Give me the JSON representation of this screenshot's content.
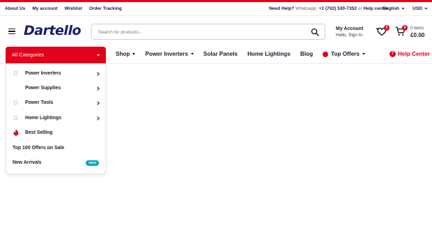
{
  "topbar": {
    "links": [
      "About Us",
      "My account",
      "Wishlist",
      "Order Tracking"
    ],
    "help_prefix": "Need Help?",
    "help_channel": "Whatsapp:",
    "help_phone": "+1 (702) 530-7352",
    "help_or": "or",
    "help_center": "Help center",
    "language": "English",
    "currency": "USD"
  },
  "header": {
    "logo": "Dartello",
    "search_placeholder": "Search for products...",
    "account_title": "My Account",
    "account_sub": "Hello, Sign In",
    "wishlist_count": "0",
    "cart_count": "0",
    "cart_items": "0 items",
    "cart_total": "£0.00"
  },
  "nav": {
    "all_categories": "All Categories",
    "items": [
      {
        "label": "Shop",
        "dropdown": true
      },
      {
        "label": "Power Inverters",
        "dropdown": true
      },
      {
        "label": "Solar Panels",
        "dropdown": false
      },
      {
        "label": "Home Lightings",
        "dropdown": false
      },
      {
        "label": "Blog",
        "dropdown": false
      },
      {
        "label": "Top Offers",
        "dropdown": true
      }
    ],
    "help_center": "Help Center"
  },
  "categories": [
    {
      "label": "Power Inverters",
      "icon": "box-icon",
      "submenu": true
    },
    {
      "label": "Power Supplies",
      "icon": "none",
      "submenu": true
    },
    {
      "label": "Power Tools",
      "icon": "box-icon",
      "submenu": true
    },
    {
      "label": "Home Lightings",
      "icon": "box-icon",
      "submenu": true
    },
    {
      "label": "Best Selling",
      "icon": "flame-icon",
      "submenu": false
    },
    {
      "label": "Top 100 Offers on Sale",
      "icon": "none",
      "submenu": false
    },
    {
      "label": "New Arrivals",
      "icon": "none",
      "submenu": false,
      "badge": "NEW"
    }
  ],
  "colors": {
    "accent": "#e3001b",
    "brand": "#1c1b6e",
    "new_badge": "#0aa5c8"
  }
}
